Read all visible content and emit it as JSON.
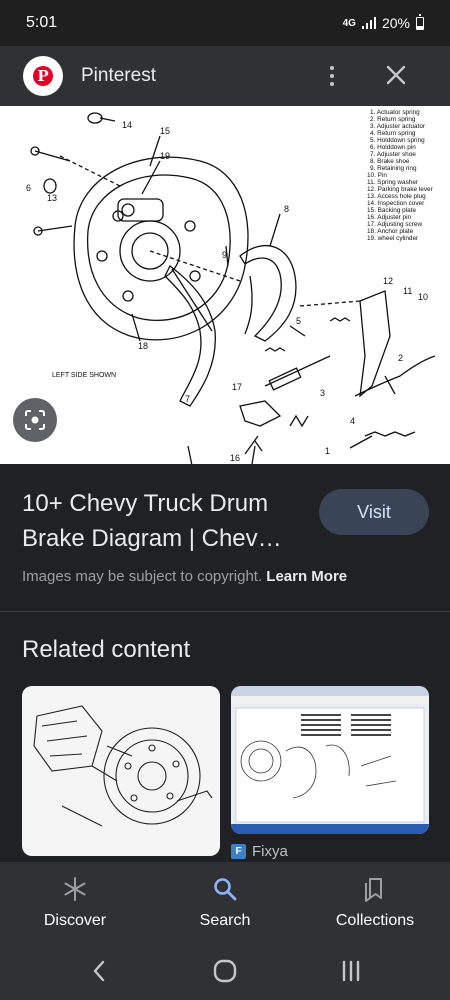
{
  "status_bar": {
    "time": "5:01",
    "network": "4G",
    "battery": "20%"
  },
  "app_bar": {
    "title": "Pinterest",
    "logo_letter": "P",
    "menu_icon": "more-vert-icon",
    "close_icon": "close-icon"
  },
  "image": {
    "caption": "LEFT SIDE SHOWN",
    "callouts": [
      "14",
      "15",
      "19",
      "6",
      "13",
      "8",
      "9",
      "7",
      "18",
      "12",
      "11",
      "10",
      "5",
      "2",
      "17",
      "3",
      "4",
      "16",
      "1"
    ],
    "legend": [
      "1. Actuator spring",
      "2. Return spring",
      "3. Adjuster actuator",
      "4. Return spring",
      "5. Holddown spring",
      "6. Holddown pin",
      "7. Adjuster shoe",
      "8. Brake shoe",
      "9. Retaining ring",
      "10. Pin",
      "11. Spring washer",
      "12. Parking brake lever",
      "13. Access hole plug",
      "14. Inspection cover",
      "15. Backing plate",
      "16. Adjuster pin",
      "17. Adjusting screw",
      "18. Anchor plate",
      "19. wheel cylinder"
    ],
    "lens_icon": "google-lens-icon"
  },
  "result": {
    "title_line1": "10+ Chevy Truck Drum",
    "title_line2": "Brake Diagram | Chev…",
    "visit_label": "Visit",
    "copyright_text": "Images may be subject to copyright.",
    "learn_more": "Learn More"
  },
  "related": {
    "heading": "Related content",
    "cards": [
      {
        "source": ""
      },
      {
        "source": "Fixya"
      }
    ]
  },
  "bottom_nav": [
    {
      "label": "Discover",
      "icon": "asterisk-icon"
    },
    {
      "label": "Search",
      "icon": "search-icon"
    },
    {
      "label": "Collections",
      "icon": "collections-icon"
    }
  ],
  "system_nav": {
    "back_icon": "back-icon",
    "home_icon": "home-icon",
    "recents_icon": "recents-icon"
  }
}
